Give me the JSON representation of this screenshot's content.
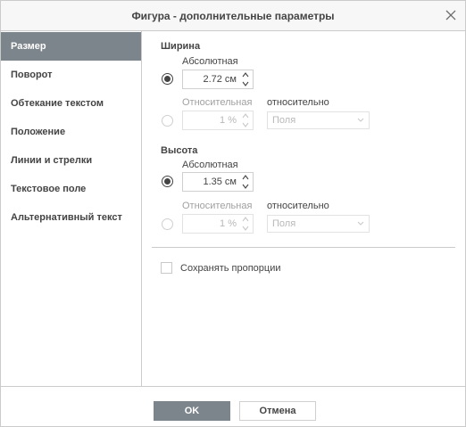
{
  "dialog": {
    "title": "Фигура - дополнительные параметры"
  },
  "sidebar": {
    "items": [
      {
        "label": "Размер",
        "active": true
      },
      {
        "label": "Поворот"
      },
      {
        "label": "Обтекание текстом"
      },
      {
        "label": "Положение"
      },
      {
        "label": "Линии и стрелки"
      },
      {
        "label": "Текстовое поле"
      },
      {
        "label": "Альтернативный текст"
      }
    ]
  },
  "size": {
    "width": {
      "title": "Ширина",
      "absolute_label": "Абсолютная",
      "absolute_value": "2.72 см",
      "relative_label": "Относительная",
      "relative_value": "1 %",
      "relative_to_label": "относительно",
      "relative_to_value": "Поля"
    },
    "height": {
      "title": "Высота",
      "absolute_label": "Абсолютная",
      "absolute_value": "1.35 см",
      "relative_label": "Относительная",
      "relative_value": "1 %",
      "relative_to_label": "относительно",
      "relative_to_value": "Поля"
    },
    "keep_ratio_label": "Сохранять пропорции"
  },
  "footer": {
    "ok_label": "OK",
    "cancel_label": "Отмена"
  },
  "colors": {
    "accent": "#7d858c",
    "border": "#cbcbcb",
    "text": "#444444"
  },
  "icons": {
    "close": "close-icon",
    "spin_up": "chevron-up-icon",
    "spin_down": "chevron-down-icon",
    "select_caret": "caret-down-icon"
  }
}
